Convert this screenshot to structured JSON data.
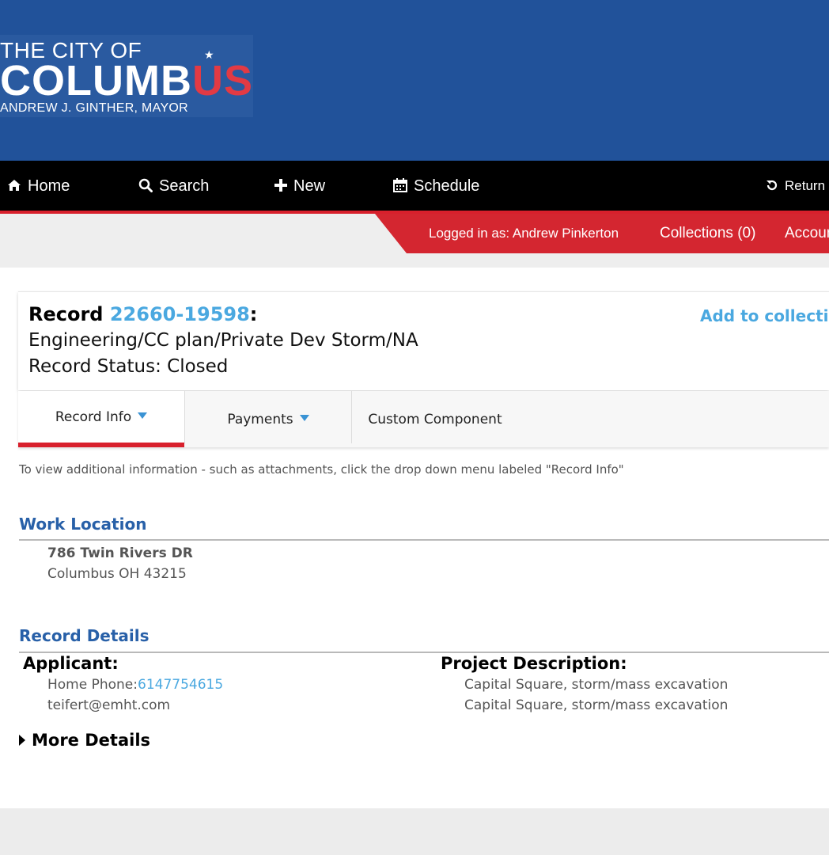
{
  "logo": {
    "line1": "THE CITY OF",
    "line2_main": "COLUMB",
    "line2_accent": "US",
    "line3": "ANDREW J. GINTHER, MAYOR",
    "star": "★"
  },
  "nav": {
    "home": {
      "label": "Home",
      "icon": "home-icon",
      "glyph": "⌂"
    },
    "search": {
      "label": "Search",
      "icon": "search-icon",
      "glyph": "⌕"
    },
    "new": {
      "label": "New",
      "icon": "plus-icon",
      "glyph": "✚"
    },
    "schedule": {
      "label": "Schedule",
      "icon": "calendar-icon",
      "glyph": "▦"
    },
    "return": {
      "label": "Return",
      "icon": "return-icon",
      "glyph": "↺"
    }
  },
  "subbar": {
    "logged_in": "Logged in as: Andrew Pinkerton",
    "collections": "Collections (0)",
    "account": "Accoun"
  },
  "record": {
    "prefix": "Record ",
    "number": "22660-19598",
    "colon": ":",
    "type": "Engineering/CC plan/Private Dev Storm/NA",
    "status": "Record Status: Closed",
    "add_to_collection": "Add to collectio"
  },
  "tabs": {
    "record_info": "Record Info",
    "payments": "Payments",
    "custom_component": "Custom Component"
  },
  "hint": "To view additional information - such as attachments, click the drop down menu labeled \"Record Info\"",
  "work_location": {
    "title": "Work Location",
    "address_line1": "786 Twin Rivers DR",
    "address_line2": "Columbus OH 43215"
  },
  "record_details": {
    "title": "Record Details",
    "applicant_label": "Applicant:",
    "home_phone_label": "Home Phone:",
    "home_phone": "6147754615",
    "email": "teifert@emht.com",
    "project_description_label": "Project Description:",
    "project_description_1": "Capital Square, storm/mass excavation",
    "project_description_2": "Capital Square, storm/mass excavation",
    "more_details": "More Details"
  },
  "colors": {
    "header_blue": "#21529a",
    "accent_red": "#d42630",
    "link_blue": "#4aa8e0",
    "section_blue": "#2860a8"
  }
}
